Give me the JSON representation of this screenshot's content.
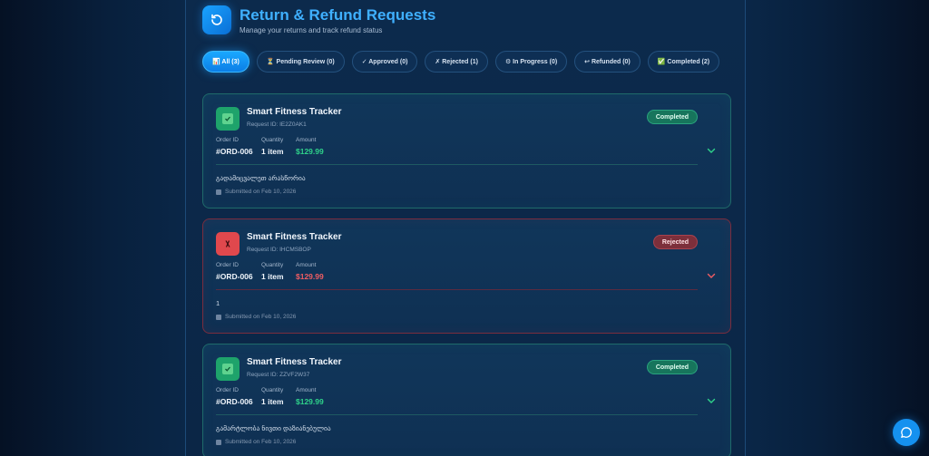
{
  "header": {
    "title": "Return & Refund Requests",
    "subtitle": "Manage your returns and track refund status",
    "icon": "refresh-icon"
  },
  "tabs": [
    {
      "label": "📊 All (3)",
      "active": true
    },
    {
      "label": "⏳ Pending Review (0)",
      "active": false
    },
    {
      "label": "✓ Approved (0)",
      "active": false
    },
    {
      "label": "✗ Rejected (1)",
      "active": false
    },
    {
      "label": "⚙ In Progress (0)",
      "active": false
    },
    {
      "label": "↩ Refunded (0)",
      "active": false
    },
    {
      "label": "✅ Completed (2)",
      "active": false
    }
  ],
  "field_labels": {
    "order": "Order ID",
    "quantity": "Quantity",
    "amount": "Amount"
  },
  "requests": [
    {
      "product": "Smart Fitness Tracker",
      "request_id": "Request ID: IE2Z0AK1",
      "status": "Completed",
      "order_id": "#ORD-006",
      "quantity": "1 item",
      "amount": "$129.99",
      "reason": "გადამიცვალეთ არასწორია",
      "submitted": "Submitted on Feb 10, 2026"
    },
    {
      "product": "Smart Fitness Tracker",
      "request_id": "Request ID: IHCMSBOP",
      "status": "Rejected",
      "order_id": "#ORD-006",
      "quantity": "1 item",
      "amount": "$129.99",
      "reason": "1",
      "submitted": "Submitted on Feb 10, 2026"
    },
    {
      "product": "Smart Fitness Tracker",
      "request_id": "Request ID: ZZVF2W37",
      "status": "Completed",
      "order_id": "#ORD-006",
      "quantity": "1 item",
      "amount": "$129.99",
      "reason": "გამარტლობა ნივთი დაზიანებულია",
      "submitted": "Submitted on Feb 10, 2026"
    }
  ],
  "colors": {
    "accent": "#3fb0ff",
    "completed": "#2fd28a",
    "rejected": "#f05d63"
  },
  "chat": {
    "icon": "chat-bubble-icon"
  }
}
